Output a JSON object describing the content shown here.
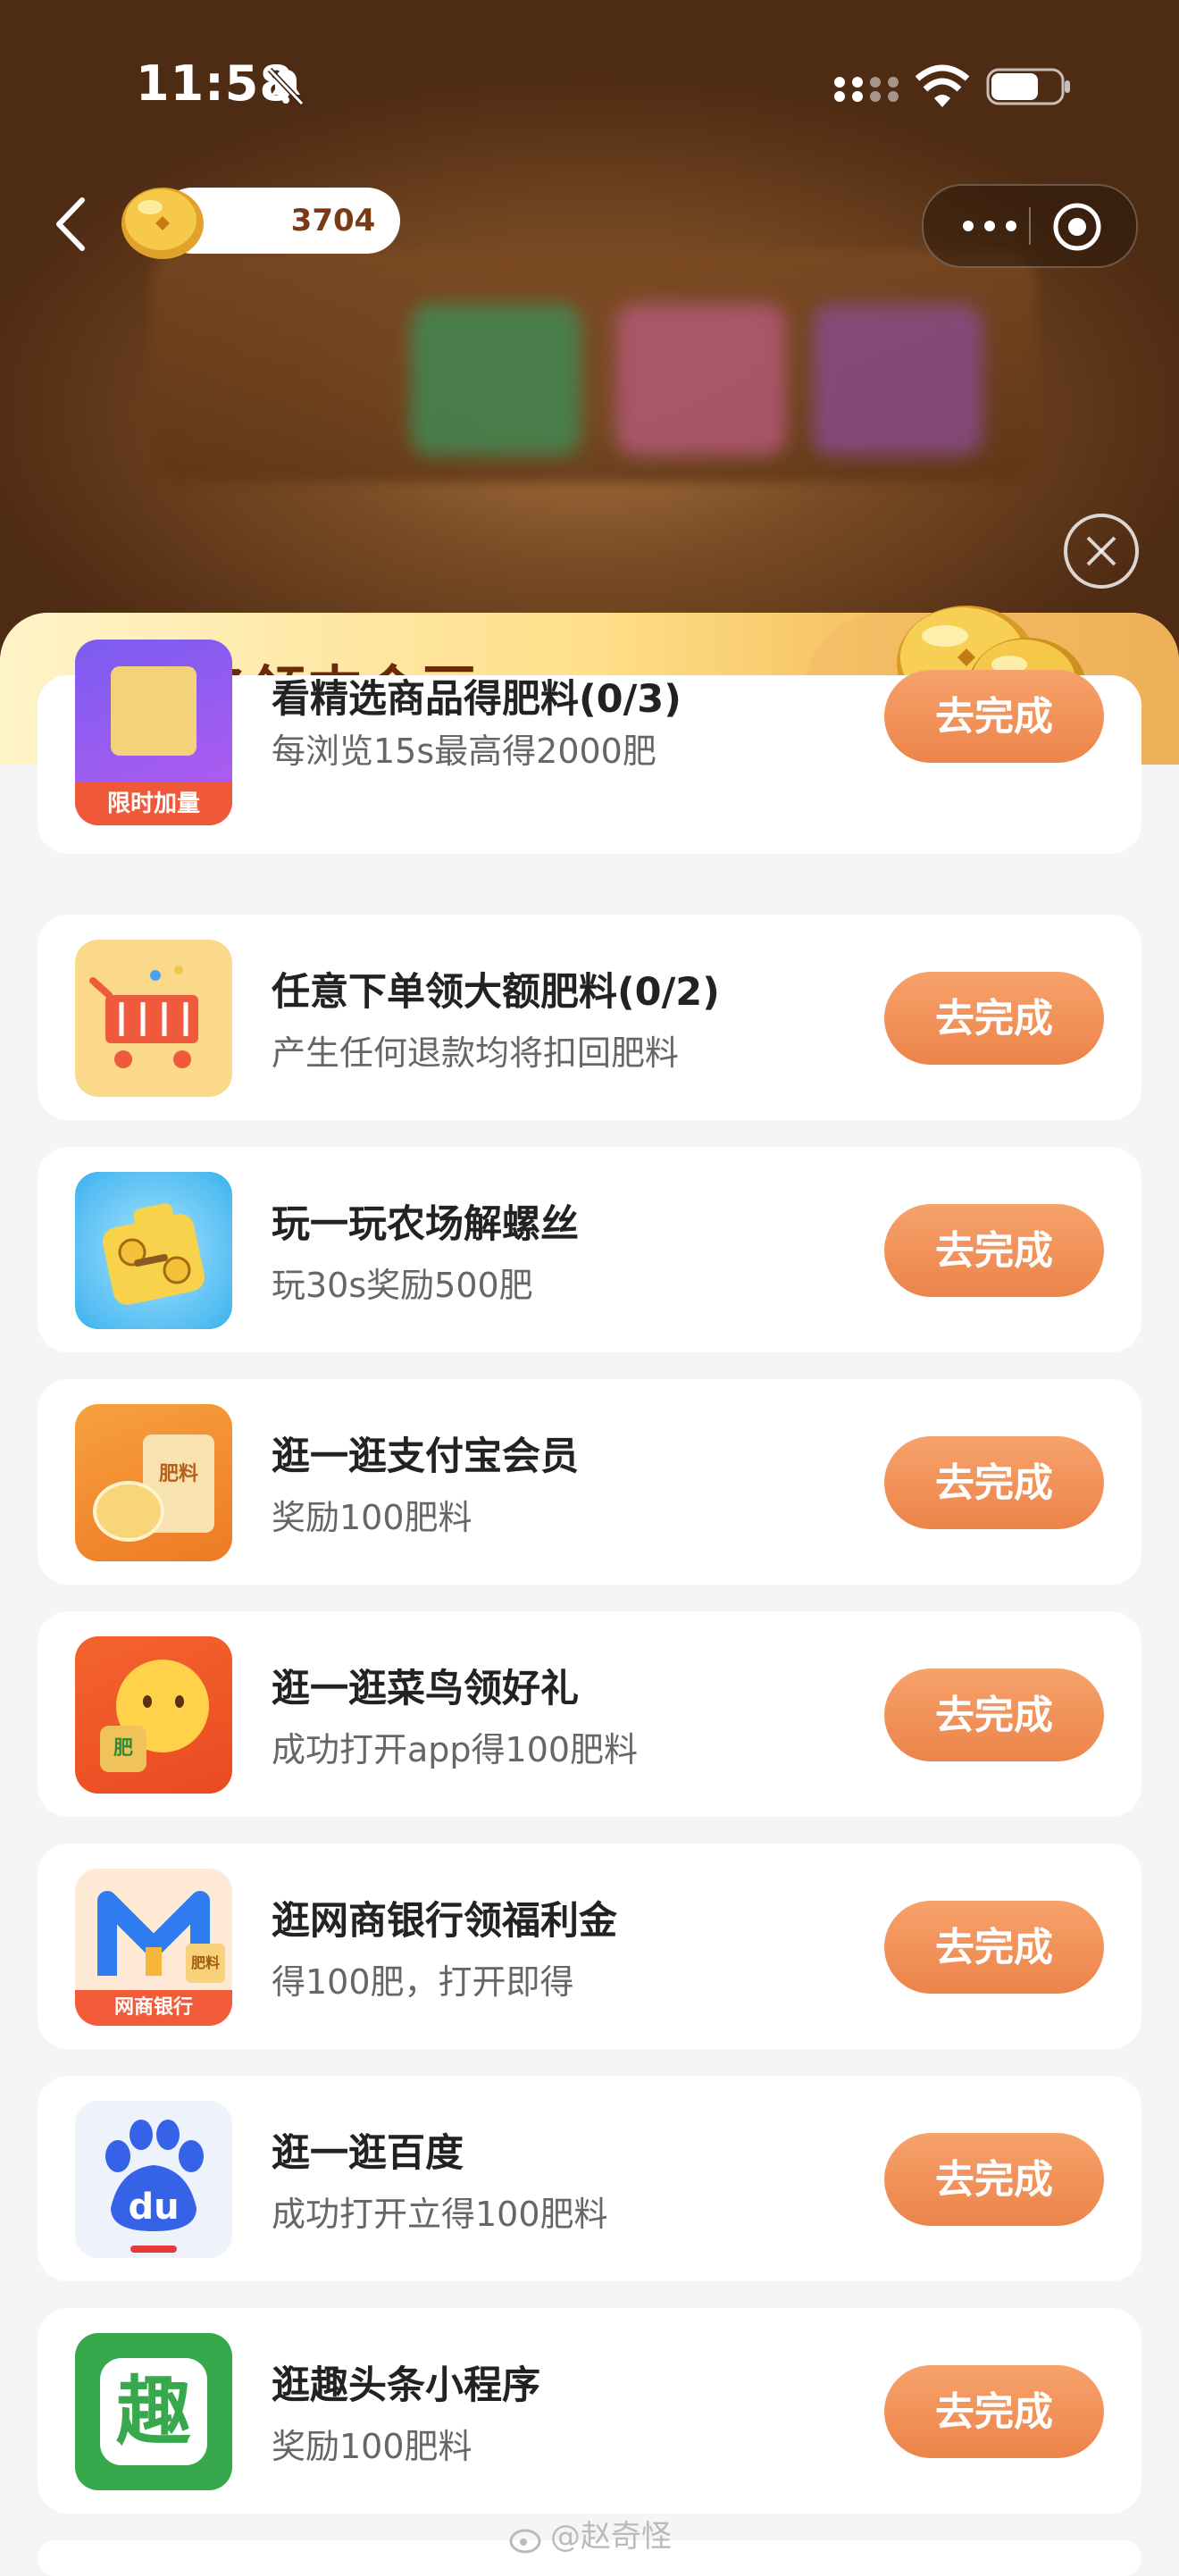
{
  "status_bar": {
    "time": "11:58"
  },
  "header": {
    "coin_count": "3704"
  },
  "sheet": {
    "title": "做任务领支金豆"
  },
  "tasks": [
    {
      "title": "看精选商品得肥料(0/3)",
      "subtitle": "每浏览15s最高得2000肥",
      "button": "去完成",
      "badge": "限时加量",
      "icon": "gift-box-icon"
    },
    {
      "title": "任意下单领大额肥料(0/2)",
      "subtitle": "产生任何退款均将扣回肥料",
      "button": "去完成",
      "icon": "shopping-cart-icon"
    },
    {
      "title": "玩一玩农场解螺丝",
      "subtitle": "玩30s奖励500肥",
      "button": "去完成",
      "icon": "screw-game-icon"
    },
    {
      "title": "逛一逛支付宝会员",
      "subtitle": "奖励100肥料",
      "button": "去完成",
      "badge": "肥料",
      "icon": "alipay-member-icon"
    },
    {
      "title": "逛一逛菜鸟领好礼",
      "subtitle": "成功打开app得100肥料",
      "button": "去完成",
      "badge": "肥",
      "icon": "cainiao-icon"
    },
    {
      "title": "逛网商银行领福利金",
      "subtitle": "得100肥，打开即得",
      "button": "去完成",
      "badge": "网商银行",
      "badge2": "肥料",
      "icon": "mybank-icon"
    },
    {
      "title": "逛一逛百度",
      "subtitle": "成功打开立得100肥料",
      "button": "去完成",
      "badge": "du",
      "icon": "baidu-icon"
    },
    {
      "title": "逛趣头条小程序",
      "subtitle": "奖励100肥料",
      "button": "去完成",
      "badge": "趣",
      "icon": "qutoutiao-icon"
    }
  ],
  "watermark": "@赵奇怪",
  "colors": {
    "accent": "#ec844a",
    "title_brown": "#6b2a0a"
  }
}
